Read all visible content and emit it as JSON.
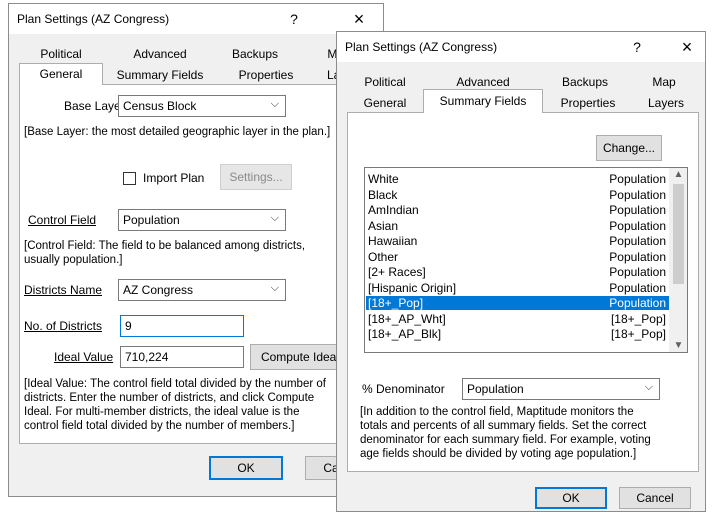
{
  "back_dialog": {
    "title": "Plan Settings (AZ Congress)",
    "help_glyph": "?",
    "close_glyph": "×",
    "tabs_row1": [
      "Political",
      "Advanced",
      "Backups",
      "Map"
    ],
    "tabs_row2": [
      "General",
      "Summary Fields",
      "Properties",
      "Layers"
    ],
    "base_layer_label": "Base Layer",
    "base_layer_value": "Census Block",
    "base_layer_note": "[Base Layer: the most detailed geographic layer in the plan.]",
    "import_plan_label": "Import Plan",
    "settings_button": "Settings...",
    "control_field_label": "Control Field",
    "control_field_value": "Population",
    "control_note": [
      "[Control Field: The field to be balanced among districts,",
      "usually population.]"
    ],
    "districts_name_label": "Districts Name",
    "districts_name_value": "AZ Congress",
    "no_districts_label": "No. of Districts",
    "no_districts_value": "9",
    "ideal_value_label": "Ideal Value",
    "ideal_value_value": "710,224",
    "compute_ideal_button": "Compute Ideal",
    "ideal_note": [
      "[Ideal Value: The control field total divided by the number of",
      "districts. Enter the number of districts, and click Compute",
      "Ideal. For multi-member districts, the ideal value is the",
      "control field total divided by the number of members.]"
    ],
    "ok_button": "OK",
    "cancel_button": "Cancel"
  },
  "front_dialog": {
    "title": "Plan Settings (AZ Congress)",
    "help_glyph": "?",
    "close_glyph": "×",
    "tabs_row1": [
      "Political",
      "Advanced",
      "Backups",
      "Map"
    ],
    "tabs_row2": [
      "General",
      "Summary Fields",
      "Properties",
      "Layers"
    ],
    "change_button": "Change...",
    "fields": [
      {
        "name": "White",
        "type": "Population"
      },
      {
        "name": "Black",
        "type": "Population"
      },
      {
        "name": "AmIndian",
        "type": "Population"
      },
      {
        "name": "Asian",
        "type": "Population"
      },
      {
        "name": "Hawaiian",
        "type": "Population"
      },
      {
        "name": "Other",
        "type": "Population"
      },
      {
        "name": "[2+ Races]",
        "type": "Population"
      },
      {
        "name": "[Hispanic Origin]",
        "type": "Population"
      },
      {
        "name": "[18+_Pop]",
        "type": "Population"
      },
      {
        "name": "[18+_AP_Wht]",
        "type": "[18+_Pop]"
      },
      {
        "name": "[18+_AP_Blk]",
        "type": "[18+_Pop]"
      }
    ],
    "selected_field": "[18+_Pop]",
    "denominator_label": "% Denominator",
    "denominator_value": "Population",
    "note": [
      "[In addition to the control field, Maptitude monitors the",
      "totals and percents of all summary fields. Set the correct",
      "denominator for each summary field. For example, voting",
      "age fields should be divided by voting age population.]"
    ],
    "ok_button": "OK",
    "cancel_button": "Cancel"
  },
  "colors": {
    "accent": "#0078d7",
    "dialog_bg": "#f0f0f0",
    "panel_bg": "#ffffff"
  }
}
